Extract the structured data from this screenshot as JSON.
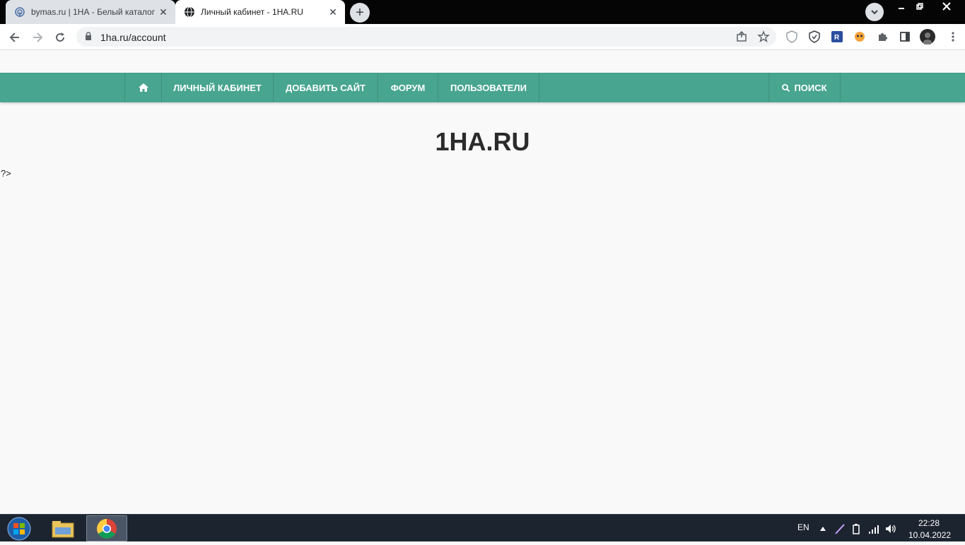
{
  "browser": {
    "tabs": [
      {
        "title": "bymas.ru | 1НА - Белый каталог",
        "close": "✕"
      },
      {
        "title": "Личный кабинет - 1HA.RU",
        "close": "✕"
      }
    ],
    "new_tab": "+",
    "url": "1ha.ru/account"
  },
  "site": {
    "nav": [
      {
        "label": "ЛИЧНЫЙ КАБИНЕТ"
      },
      {
        "label": "ДОБАВИТЬ САЙТ"
      },
      {
        "label": "ФОРУМ"
      },
      {
        "label": "ПОЛЬЗОВАТЕЛИ"
      }
    ],
    "search_label": "ПОИСК",
    "title": "1HA.RU",
    "stray_text": "?>",
    "nav_color": "#48a58f"
  },
  "taskbar": {
    "lang": "EN",
    "time": "22:28",
    "date": "10.04.2022"
  }
}
